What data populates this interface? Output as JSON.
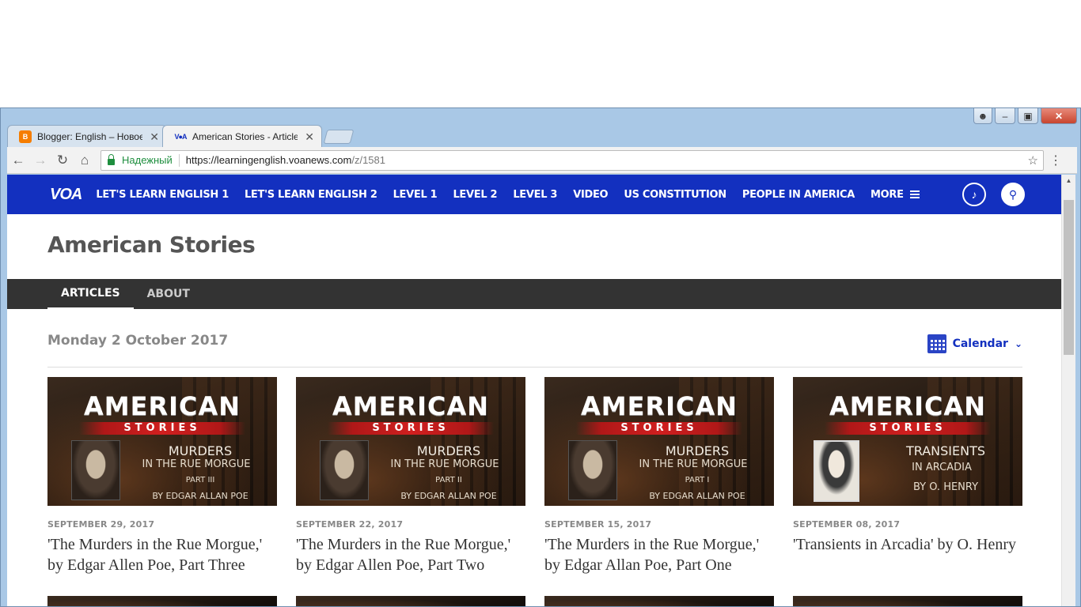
{
  "browser": {
    "tabs": [
      {
        "title": "Blogger: English – Новое",
        "active": false,
        "icon": "blogger-icon"
      },
      {
        "title": "American Stories - Articles",
        "active": true,
        "icon": "voa-icon"
      }
    ],
    "address": {
      "secure_label": "Надежный",
      "url_host": "https://learningenglish.voanews.com",
      "url_path": "/z/1581"
    }
  },
  "site": {
    "logo": "VOA",
    "nav": [
      "LET'S LEARN ENGLISH 1",
      "LET'S LEARN ENGLISH 2",
      "LEVEL 1",
      "LEVEL 2",
      "LEVEL 3",
      "VIDEO",
      "US CONSTITUTION",
      "PEOPLE IN AMERICA"
    ],
    "more_label": "MORE",
    "section_title": "American Stories",
    "subtabs": [
      "ARTICLES",
      "ABOUT"
    ],
    "current_date": "Monday 2 October 2017",
    "calendar_label": "Calendar"
  },
  "articles": [
    {
      "date": "SEPTEMBER 29, 2017",
      "title": "'The Murders in the Rue Morgue,' by Edgar Allen Poe, Part Three",
      "thumb": {
        "brand": "AMERICAN",
        "sub": "STORIES",
        "l1": "MURDERS",
        "l2": "IN THE RUE MORGUE",
        "l3": "PART III",
        "l4": "BY EDGAR ALLAN POE"
      }
    },
    {
      "date": "SEPTEMBER 22, 2017",
      "title": "'The Murders in the Rue Morgue,' by Edgar Allen Poe, Part Two",
      "thumb": {
        "brand": "AMERICAN",
        "sub": "STORIES",
        "l1": "MURDERS",
        "l2": "IN THE RUE MORGUE",
        "l3": "PART II",
        "l4": "BY EDGAR ALLAN POE"
      }
    },
    {
      "date": "SEPTEMBER 15, 2017",
      "title": "'The Murders in the Rue Morgue,' by Edgar Allan Poe, Part One",
      "thumb": {
        "brand": "AMERICAN",
        "sub": "STORIES",
        "l1": "MURDERS",
        "l2": "IN THE RUE MORGUE",
        "l3": "PART I",
        "l4": "BY EDGAR ALLAN POE"
      }
    },
    {
      "date": "SEPTEMBER 08, 2017",
      "title": "'Transients in Arcadia' by O. Henry",
      "thumb": {
        "brand": "AMERICAN",
        "sub": "STORIES",
        "l1": "TRANSIENTS",
        "l2": "IN ARCADIA",
        "l3": "",
        "l4": "BY O. HENRY"
      }
    }
  ],
  "colors": {
    "voa_blue": "#1330bf",
    "subnav_bg": "#333333"
  }
}
